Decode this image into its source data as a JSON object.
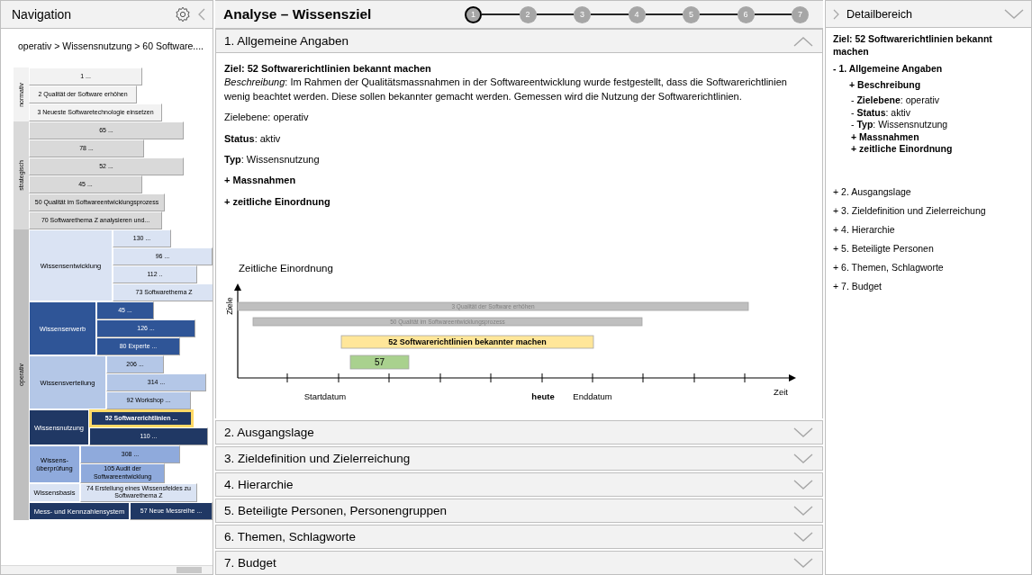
{
  "navigation": {
    "title": "Navigation",
    "breadcrumb": "operativ > Wissensnutzung > 60 Software....",
    "levels": [
      {
        "label": "normativ",
        "color": "#f2f2f2",
        "groups": [
          {
            "color": "#f2f2f2",
            "items": [
              {
                "label": "1 ...",
                "selected": false
              },
              {
                "label": "2 Qualität der Software erhöhen",
                "selected": false
              },
              {
                "label": "3 Neueste Softwaretechnologie einsetzen",
                "selected": false
              }
            ]
          }
        ]
      },
      {
        "label": "strategisch",
        "color": "#d9d9d9",
        "groups": [
          {
            "color": "#d9d9d9",
            "items": [
              {
                "label": "65 ...",
                "selected": false
              },
              {
                "label": "78 ...",
                "selected": false
              },
              {
                "label": "52 ...",
                "selected": false
              },
              {
                "label": "45 ...",
                "selected": false
              },
              {
                "label": "50 Qualität im Softwareentwicklungsprozess",
                "selected": false
              },
              {
                "label": "70 Softwarethema Z analysieren und...",
                "selected": false
              }
            ]
          }
        ]
      },
      {
        "label": "operativ",
        "color": "#bfbfbf",
        "groups": [
          {
            "label": "Wissensentwicklung",
            "color": "#dae3f3",
            "items": [
              {
                "label": "130 ...",
                "selected": false
              },
              {
                "label": "96 ...",
                "selected": false
              },
              {
                "label": "112 ..",
                "selected": false
              },
              {
                "label": "73 Softwarethema Z",
                "selected": false
              }
            ]
          },
          {
            "label": "Wissenserwerb",
            "color": "#2f5597",
            "items": [
              {
                "label": "45 ...",
                "selected": false
              },
              {
                "label": "126 ...",
                "selected": false
              },
              {
                "label": "80 Experte ...",
                "selected": false
              }
            ]
          },
          {
            "label": "Wissensverteilung",
            "color": "#b4c7e7",
            "items": [
              {
                "label": "206 ...",
                "selected": false
              },
              {
                "label": "314 ...",
                "selected": false
              },
              {
                "label": "92 Workshop ...",
                "selected": false
              }
            ]
          },
          {
            "label": "Wissensnutzung",
            "color": "#203864",
            "items": [
              {
                "label": "52 Softwarerichtlinien ...",
                "selected": true
              },
              {
                "label": "110 ...",
                "selected": false
              }
            ]
          },
          {
            "label": "Wissens-\nüberprüfung",
            "color": "#8faadc",
            "items": [
              {
                "label": "308 ...",
                "selected": false
              },
              {
                "label": "105 Audit der\nSoftwareentwicklung",
                "selected": false
              }
            ]
          },
          {
            "label": "Wissensbasis",
            "color": "#dae3f3",
            "items": [
              {
                "label": "74 Erstellung eines Wissensfeldes zu\nSoftwarethema Z",
                "selected": false
              }
            ]
          },
          {
            "label": "Mess- und Kennzahlensystem",
            "color": "#203864",
            "items": [
              {
                "label": "57 Neue Messreihe ...",
                "selected": false
              }
            ]
          }
        ]
      }
    ]
  },
  "main": {
    "title": "Analyse – Wissensziel",
    "steps": [
      {
        "label": "1",
        "selected": true
      },
      {
        "label": "2",
        "selected": false
      },
      {
        "label": "3",
        "selected": false
      },
      {
        "label": "4",
        "selected": false
      },
      {
        "label": "5",
        "selected": false
      },
      {
        "label": "6",
        "selected": false
      },
      {
        "label": "7",
        "selected": false
      }
    ],
    "sections": [
      {
        "title": "1. Allgemeine Angaben",
        "expanded": true,
        "lines": [
          {
            "kind": "heading",
            "text": "Ziel: 52 Softwarerichtlinien bekannt machen"
          },
          {
            "kind": "text",
            "text": "*Beschreibung*: Im Rahmen der Qualitätsmassnahmen in der Softwareentwicklung wurde festgestellt, dass die Softwarerichtlinien wenig beachtet werden. Diese sollen bekannter gemacht werden. Gemessen wird die Nutzung der Softwarerichtlinien."
          },
          {
            "kind": "text",
            "text": "Zielebene: operativ"
          },
          {
            "kind": "text",
            "text": "**Status**: aktiv"
          },
          {
            "kind": "text",
            "text": "**Typ**: Wissensnutzung"
          },
          {
            "kind": "group",
            "text": "+ Massnahmen"
          },
          {
            "kind": "group",
            "text": "+ zeitliche Einordnung"
          }
        ],
        "timeline": {
          "title": "Zeitliche Einordnung",
          "ylabel": "Ziele",
          "xlabel": "Zeit",
          "bars": [
            {
              "label": "3 Qualität der Software erhöhen",
              "kind": "context"
            },
            {
              "label": "50 Qualität im Softwareentwicklungsprozess",
              "kind": "context"
            },
            {
              "label": "52 Softwarerichtlinien bekannter machen",
              "kind": "current"
            },
            {
              "label": "57",
              "kind": "measure"
            }
          ],
          "markers": [
            {
              "label": "Startdatum",
              "kind": "date"
            },
            {
              "label": "heute",
              "kind": "today"
            },
            {
              "label": "Enddatum",
              "kind": "date"
            }
          ]
        }
      },
      {
        "title": "2. Ausgangslage",
        "expanded": false
      },
      {
        "title": "3. Zieldefinition und Zielerreichung",
        "expanded": false
      },
      {
        "title": "4. Hierarchie",
        "expanded": false
      },
      {
        "title": "5. Beteiligte Personen, Personengruppen",
        "expanded": false
      },
      {
        "title": "6. Themen, Schlagworte",
        "expanded": false
      },
      {
        "title": "7. Budget",
        "expanded": false
      }
    ]
  },
  "detail": {
    "title": "Detailbereich",
    "goal": "Ziel: 52 Softwarerichtlinien bekannt machen",
    "tree": [
      {
        "label": "- 1. Allgemeine Angaben",
        "expanded": true,
        "children": [
          {
            "kind": "group",
            "label": "+ Beschreibung"
          },
          {
            "kind": "field",
            "label": "- **Zielebene**: operativ"
          },
          {
            "kind": "field",
            "label": "- **Status**: aktiv"
          },
          {
            "kind": "field",
            "label": "- **Typ**: Wissensnutzung"
          },
          {
            "kind": "group",
            "label": "+ Massnahmen"
          },
          {
            "kind": "group",
            "label": "+ zeitliche Einordnung"
          }
        ]
      },
      {
        "label": "+ 2. Ausgangslage",
        "expanded": false
      },
      {
        "label": "+ 3. Zieldefinition und Zielerreichung",
        "expanded": false
      },
      {
        "label": "+ 4. Hierarchie",
        "expanded": false
      },
      {
        "label": "+ 5. Beteiligte Personen",
        "expanded": false
      },
      {
        "label": "+ 6. Themen, Schlagworte",
        "expanded": false
      },
      {
        "label": "+ 7. Budget",
        "expanded": false
      }
    ]
  }
}
